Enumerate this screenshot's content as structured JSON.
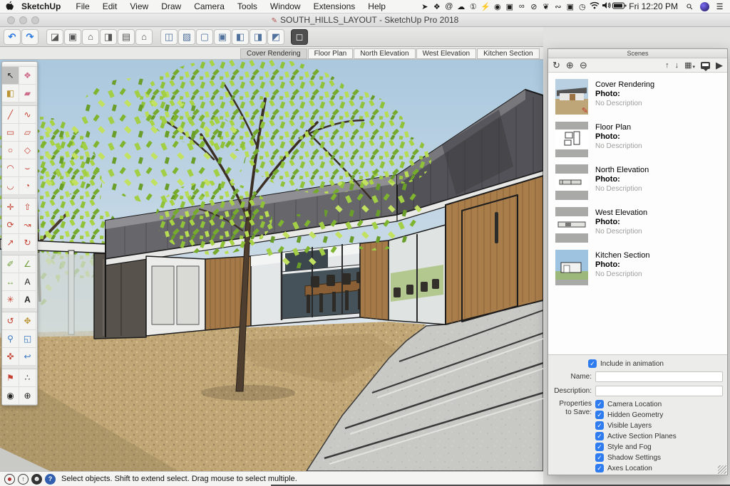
{
  "menubar": {
    "app_name": "SketchUp",
    "menus": [
      "File",
      "Edit",
      "View",
      "Draw",
      "Camera",
      "Tools",
      "Window",
      "Extensions",
      "Help"
    ],
    "status_icons": [
      {
        "name": "location-icon",
        "glyph": "➤"
      },
      {
        "name": "dropbox-icon",
        "glyph": "❖"
      },
      {
        "name": "at-symbol-icon",
        "glyph": "@"
      },
      {
        "name": "cloud-sync-icon",
        "glyph": "☁"
      },
      {
        "name": "alert-circle-icon",
        "glyph": "①"
      },
      {
        "name": "flame-icon",
        "glyph": "⚡"
      },
      {
        "name": "bell-icon",
        "glyph": "◉"
      },
      {
        "name": "camtasia-icon",
        "glyph": "▣"
      },
      {
        "name": "infinity-icon",
        "glyph": "∞"
      },
      {
        "name": "do-not-disturb-icon",
        "glyph": "⊘"
      },
      {
        "name": "evernote-icon",
        "glyph": "❦"
      },
      {
        "name": "glasses-icon",
        "glyph": "∾"
      },
      {
        "name": "screen-record-icon",
        "glyph": "▣"
      },
      {
        "name": "time-machine-icon",
        "glyph": "◷"
      }
    ],
    "clock": "Fri 12:20 PM",
    "spotlight_glyph": "⚲",
    "notification_glyph": "☰"
  },
  "window": {
    "title": "SOUTH_HILLS_LAYOUT - SketchUp Pro 2018",
    "doc_icon": "✎"
  },
  "toolbar": {
    "undo": "↶",
    "redo": "↷",
    "views": [
      {
        "name": "view-iso-button",
        "glyph": "◪"
      },
      {
        "name": "view-top-button",
        "glyph": "▣"
      },
      {
        "name": "view-front-button",
        "glyph": "⌂"
      },
      {
        "name": "view-right-button",
        "glyph": "◨"
      },
      {
        "name": "view-back-button",
        "glyph": "▤"
      },
      {
        "name": "view-left-button",
        "glyph": "⌂"
      }
    ],
    "styles": [
      {
        "name": "style-xray-button",
        "glyph": "◫"
      },
      {
        "name": "style-back-edges-button",
        "glyph": "▨"
      },
      {
        "name": "style-wireframe-button",
        "glyph": "▢"
      },
      {
        "name": "style-hidden-line-button",
        "glyph": "▣"
      },
      {
        "name": "style-shaded-button",
        "glyph": "◧"
      },
      {
        "name": "style-textured-button",
        "glyph": "◨"
      },
      {
        "name": "style-monochrome-button",
        "glyph": "◩"
      }
    ],
    "active_style_glyph": "◻"
  },
  "scene_tabs": [
    "Cover Rendering",
    "Floor Plan",
    "North Elevation",
    "West Elevation",
    "Kitchen Section"
  ],
  "tool_palette": {
    "tools": [
      {
        "name": "select",
        "glyph": "↖"
      },
      {
        "name": "make-component",
        "glyph": "❖"
      },
      {
        "name": "paint-bucket",
        "glyph": "◧"
      },
      {
        "name": "eraser",
        "glyph": "▰"
      },
      {
        "name": "line",
        "glyph": "╱"
      },
      {
        "name": "freehand",
        "glyph": "∿"
      },
      {
        "name": "rectangle",
        "glyph": "▭"
      },
      {
        "name": "rotated-rectangle",
        "glyph": "▱"
      },
      {
        "name": "circle",
        "glyph": "○"
      },
      {
        "name": "polygon",
        "glyph": "◇"
      },
      {
        "name": "arc",
        "glyph": "◠"
      },
      {
        "name": "two-point-arc",
        "glyph": "⌣"
      },
      {
        "name": "three-point-arc",
        "glyph": "◡"
      },
      {
        "name": "pie",
        "glyph": "◔"
      },
      {
        "name": "move",
        "glyph": "✛"
      },
      {
        "name": "push-pull",
        "glyph": "⇧"
      },
      {
        "name": "rotate",
        "glyph": "⟳"
      },
      {
        "name": "follow-me",
        "glyph": "↝"
      },
      {
        "name": "scale",
        "glyph": "↗"
      },
      {
        "name": "offset",
        "glyph": "↻"
      },
      {
        "name": "tape-measure",
        "glyph": "✐"
      },
      {
        "name": "protractor",
        "glyph": "∠"
      },
      {
        "name": "dimension",
        "glyph": "↔"
      },
      {
        "name": "text",
        "glyph": "A"
      },
      {
        "name": "axes",
        "glyph": "✳"
      },
      {
        "name": "3d-text",
        "glyph": "A"
      },
      {
        "name": "orbit",
        "glyph": "↺"
      },
      {
        "name": "pan",
        "glyph": "✥"
      },
      {
        "name": "zoom",
        "glyph": "⚲"
      },
      {
        "name": "zoom-window",
        "glyph": "◱"
      },
      {
        "name": "zoom-extents",
        "glyph": "✜"
      },
      {
        "name": "previous",
        "glyph": "↩"
      },
      {
        "name": "position-camera",
        "glyph": "⚑"
      },
      {
        "name": "walk",
        "glyph": "∴"
      },
      {
        "name": "look-around",
        "glyph": "◉"
      },
      {
        "name": "section-plane",
        "glyph": "⊕"
      }
    ]
  },
  "scenes_panel": {
    "title": "Scenes",
    "items": [
      {
        "name": "Cover Rendering",
        "photo": "Photo:",
        "desc": "No Description"
      },
      {
        "name": "Floor Plan",
        "photo": "Photo:",
        "desc": "No Description"
      },
      {
        "name": "North Elevation",
        "photo": "Photo:",
        "desc": "No Description"
      },
      {
        "name": "West Elevation",
        "photo": "Photo:",
        "desc": "No Description"
      },
      {
        "name": "Kitchen Section",
        "photo": "Photo:",
        "desc": "No Description"
      }
    ],
    "include_label": "Include in animation",
    "name_label": "Name:",
    "desc_label": "Description:",
    "props_label_1": "Properties",
    "props_label_2": "to Save:",
    "properties": [
      "Camera Location",
      "Hidden Geometry",
      "Visible Layers",
      "Active Section Planes",
      "Style and Fog",
      "Shadow Settings",
      "Axes Location"
    ],
    "check_glyph": "✓"
  },
  "statusbar": {
    "message": "Select objects. Shift to extend select. Drag mouse to select multiple."
  },
  "colors": {
    "accent_blue": "#2f7cf0",
    "roof_grey": "#5a5a5e",
    "wood": "#a87c4a",
    "gravel": "#c1a676",
    "leaf_green": "#8fc238"
  }
}
